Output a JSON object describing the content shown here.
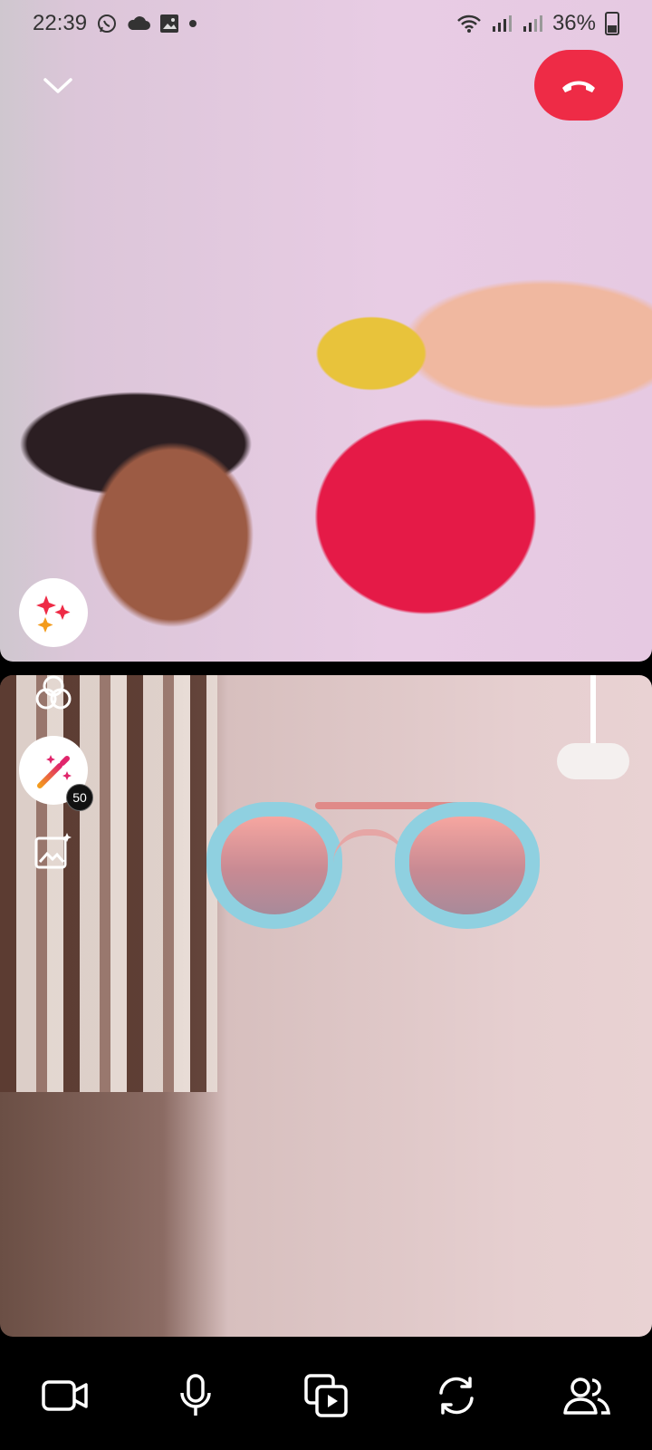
{
  "status_bar": {
    "time": "22:39",
    "left_icons": [
      "whatsapp-icon",
      "cloud-icon",
      "image-icon",
      "dot-icon"
    ],
    "right_icons": [
      "wifi-icon",
      "signal-icon",
      "signal-icon"
    ],
    "battery": "36%"
  },
  "call": {
    "state": "video call in progress",
    "badge_count": "50"
  },
  "colors": {
    "end_call": "#ee2b46",
    "background": "#000000"
  },
  "bottom_controls": [
    "video-camera-icon",
    "microphone-icon",
    "screen-share-icon",
    "switch-camera-icon",
    "participants-icon"
  ]
}
